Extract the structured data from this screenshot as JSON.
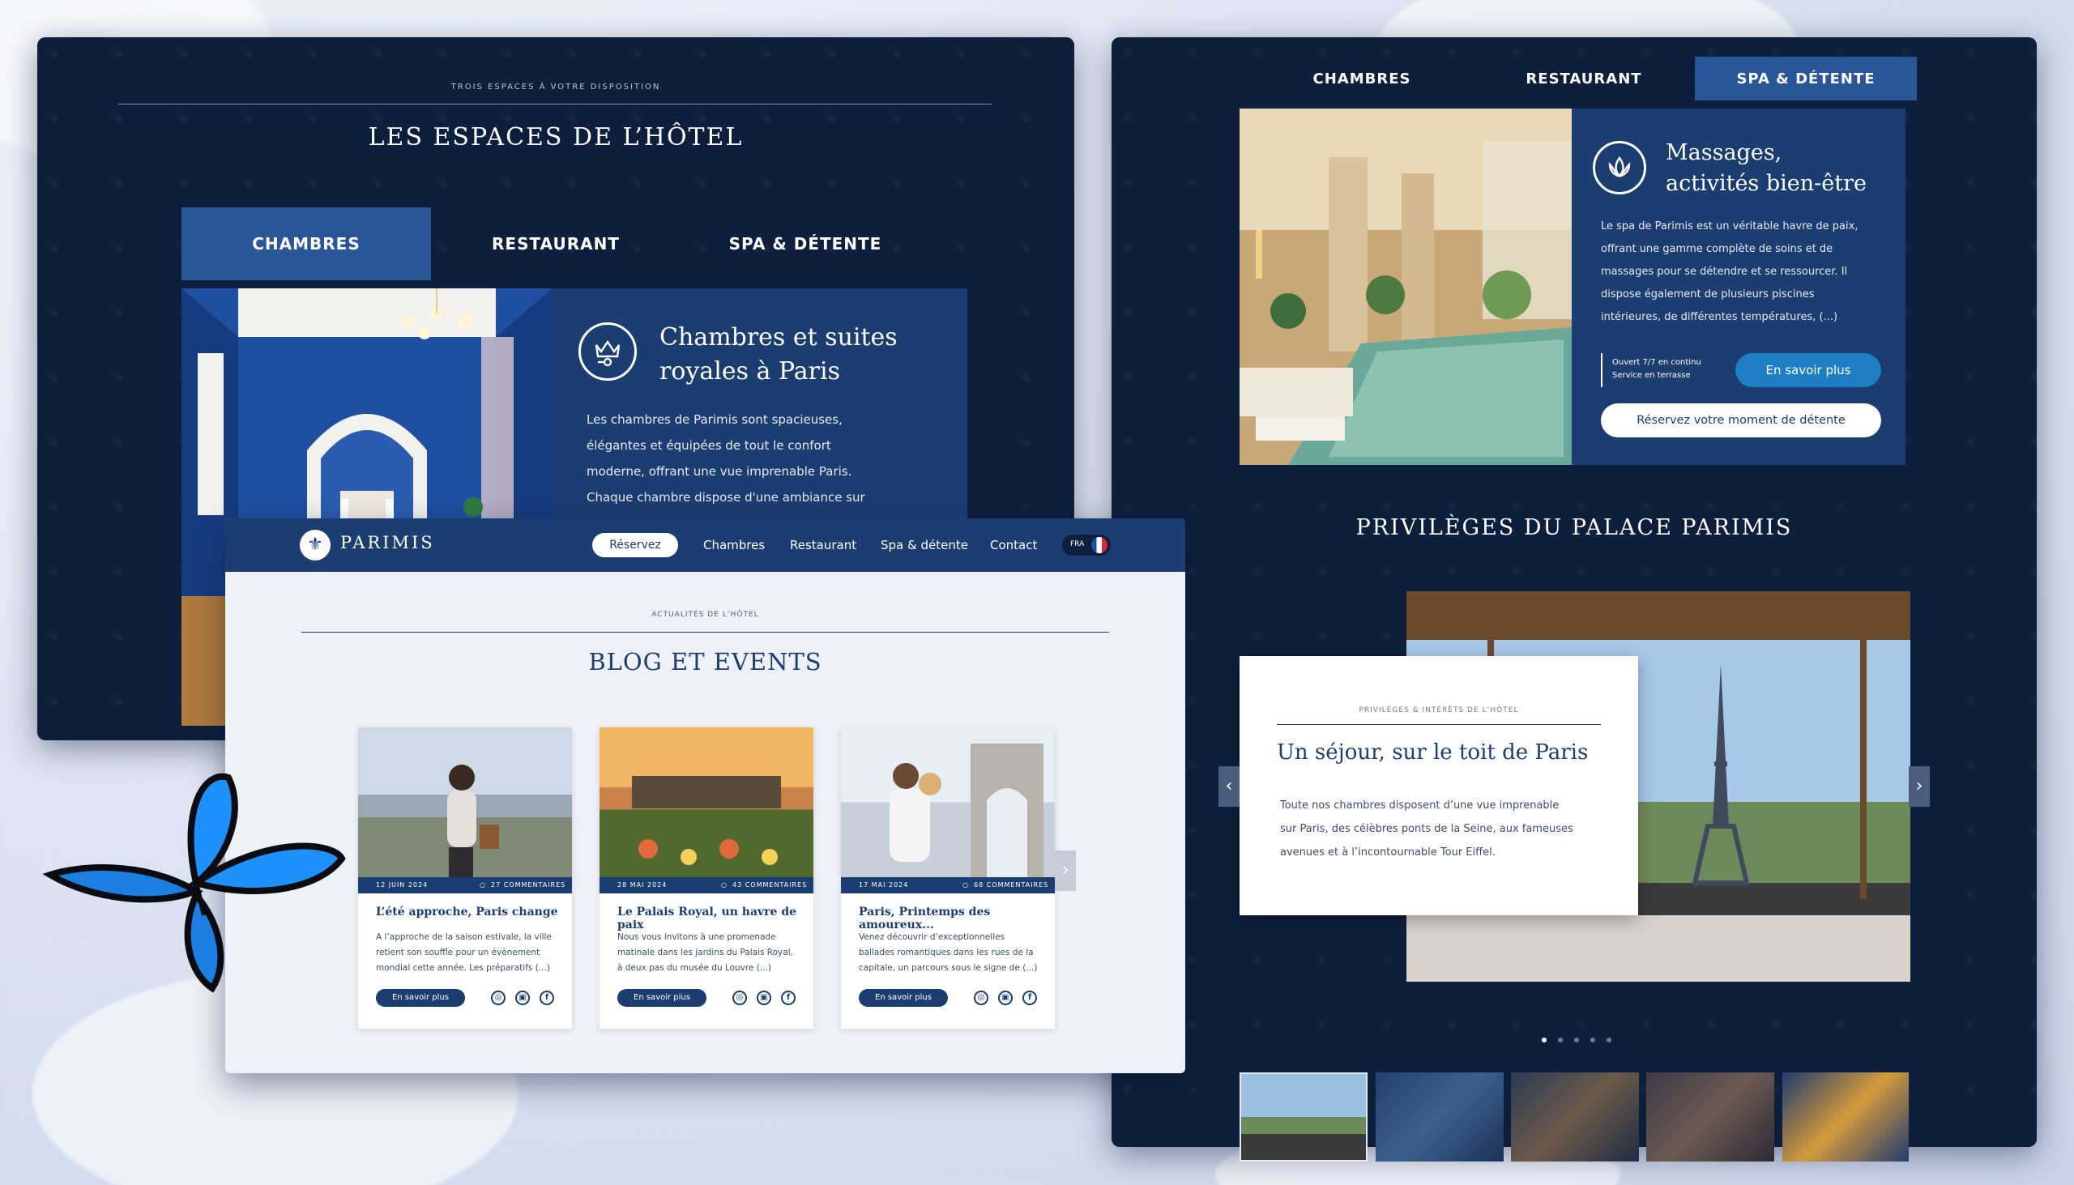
{
  "hotel_spaces": {
    "kicker": "TROIS ESPACES À VOTRE DISPOSITION",
    "title": "LES ESPACES DE L’HÔTEL",
    "tabs": [
      "CHAMBRES",
      "RESTAURANT",
      "SPA & DÉTENTE"
    ],
    "active_tab": "CHAMBRES",
    "card": {
      "title_line1": "Chambres et suites",
      "title_line2": "royales à Paris",
      "text": [
        "Les chambres de Parimis sont spacieuses,",
        "élégantes et équipées de tout le confort",
        "moderne, offrant une vue imprenable Paris.",
        "Chaque chambre dispose d'une ambiance sur"
      ]
    }
  },
  "blog": {
    "nav": {
      "logo": "PARIMIS",
      "reserve": "Réservez",
      "links": [
        "Chambres",
        "Restaurant",
        "Spa & détente",
        "Contact"
      ],
      "lang": "FRA"
    },
    "kicker": "ACTUALITÉS DE L’HÔTEL",
    "title": "BLOG ET EVENTS",
    "cards": [
      {
        "date": "12 JUIN 2024",
        "comments": "27 COMMENTAIRES",
        "title": "L’été approche, Paris change",
        "excerpt": [
          "A l’approche de la saison estivale, la ville",
          "retient son souffle pour un évènement",
          "mondial cette année. Les préparatifs (...)"
        ],
        "button": "En savoir plus"
      },
      {
        "date": "28 MAI 2024",
        "comments": "43 COMMENTAIRES",
        "title": "Le Palais Royal, un havre de paix",
        "excerpt": [
          "Nous vous invitons à une promenade",
          "matinale dans les jardins du Palais Royal,",
          "à deux pas du musée du Louvre (...)"
        ],
        "button": "En savoir plus"
      },
      {
        "date": "17 MAI 2024",
        "comments": "68 COMMENTAIRES",
        "title": "Paris, Printemps des amoureux...",
        "excerpt": [
          "Venez découvrir d’exceptionnelles",
          "ballades romantiques dans les rues de la",
          "capitale, un parcours sous le signe de (...)"
        ],
        "button": "En savoir plus"
      }
    ]
  },
  "spa": {
    "tabs": [
      "CHAMBRES",
      "RESTAURANT",
      "SPA & DÉTENTE"
    ],
    "active_tab": "SPA & DÉTENTE",
    "card": {
      "title_line1": "Massages,",
      "title_line2": "activités bien-être",
      "text": [
        "Le spa de Parimis est un véritable havre de paix,",
        "offrant une gamme complète de soins et de",
        "massages pour se détendre et se ressourcer. Il",
        "dispose également de plusieurs piscines",
        "intérieures, de différentes températures, (...)"
      ],
      "hours_line1": "Ouvert 7/7 en continu",
      "hours_line2": "Service en terrasse",
      "more_button": "En savoir plus",
      "reserve_button": "Réservez votre moment de détente"
    },
    "privileges": {
      "title": "PRIVILÈGES DU PALACE PARIMIS",
      "slide": {
        "kicker": "PRIVILÈGES & INTÉRÊTS DE L’HÔTEL",
        "title": "Un séjour, sur le toit de Paris",
        "text": [
          "Toute nos chambres disposent d’une vue imprenable",
          "sur Paris, des célèbres ponts de la Seine, aux fameuses",
          "avenues et à l’incontournable Tour Eiffel."
        ]
      },
      "active_dot": 1,
      "dot_count": 5
    }
  },
  "colors": {
    "navy": "#0d1f3c",
    "royal": "#1c3d70",
    "accent": "#2a5596",
    "cta": "#1f7fc4",
    "butterfly": "#1e90ff"
  },
  "icons": [
    "crown-key-icon",
    "lotus-icon",
    "fleur-de-lis-icon",
    "chevron-left-icon",
    "chevron-right-icon",
    "comment-icon",
    "instagram-icon",
    "camera-icon",
    "facebook-icon",
    "flag-icon",
    "butterfly-icon"
  ]
}
